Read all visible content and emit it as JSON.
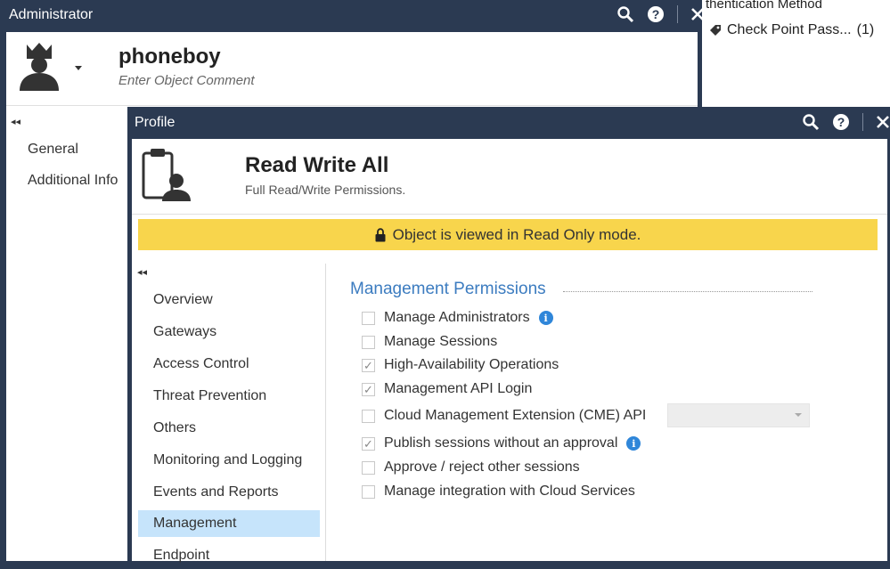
{
  "background": {
    "auth_method_label": "thentication Method",
    "auth_value": "Check Point Pass...",
    "auth_count": "(1)"
  },
  "admin_window": {
    "title": "Administrator",
    "name": "phoneboy",
    "comment_placeholder": "Enter Object Comment",
    "nav": [
      "General",
      "Additional Info"
    ],
    "collapse_glyph": "◂◂"
  },
  "profile_window": {
    "title": "Profile",
    "name": "Read Write All",
    "description": "Full Read/Write Permissions.",
    "banner": "Object is viewed in Read Only mode.",
    "collapse_glyph": "◂◂",
    "nav": [
      {
        "label": "Overview",
        "selected": false
      },
      {
        "label": "Gateways",
        "selected": false
      },
      {
        "label": "Access Control",
        "selected": false
      },
      {
        "label": "Threat Prevention",
        "selected": false
      },
      {
        "label": "Others",
        "selected": false
      },
      {
        "label": "Monitoring and Logging",
        "selected": false
      },
      {
        "label": "Events and Reports",
        "selected": false
      },
      {
        "label": "Management",
        "selected": true
      },
      {
        "label": "Endpoint",
        "selected": false
      }
    ],
    "section_title": "Management Permissions",
    "permissions": [
      {
        "label": "Manage Administrators",
        "checked": false,
        "info": true
      },
      {
        "label": "Manage Sessions",
        "checked": false,
        "info": false
      },
      {
        "label": "High-Availability Operations",
        "checked": true,
        "info": false
      },
      {
        "label": "Management API Login",
        "checked": true,
        "info": false
      },
      {
        "label": "Cloud Management Extension (CME) API",
        "checked": false,
        "info": false,
        "dropdown": true
      },
      {
        "label": "Publish sessions without an approval",
        "checked": true,
        "info": true
      },
      {
        "label": "Approve / reject other sessions",
        "checked": false,
        "info": false
      },
      {
        "label": "Manage integration with Cloud Services",
        "checked": false,
        "info": false
      }
    ]
  },
  "colors": {
    "titlebar": "#2b3a52",
    "banner": "#f8d54c",
    "selected_nav": "#c6e4fb",
    "section_title": "#3c7cc0",
    "info_icon": "#2f86d9"
  }
}
